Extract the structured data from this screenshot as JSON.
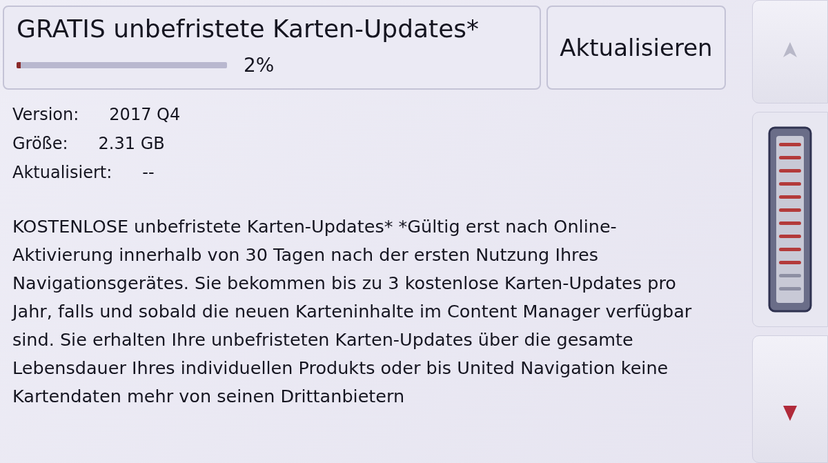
{
  "header": {
    "title": "GRATIS unbefristete Karten-Updates*",
    "progress": {
      "level": 0.02,
      "reading": "2%"
    }
  },
  "update_button": {
    "label": "Aktualisieren"
  },
  "details": [
    {
      "label": "Version:",
      "value": "2017 Q4"
    },
    {
      "label": "Größe:",
      "value": "2.31 GB"
    },
    {
      "label": "Aktualisiert:",
      "value": "--"
    }
  ],
  "description": "KOSTENLOSE unbefristete Karten-Updates* *Gültig erst nach Online-Aktivierung innerhalb von 30 Tagen nach der ersten Nutzung Ihres Navigationsgerätes. Sie bekommen bis zu 3 kostenlose Karten-Updates pro Jahr, falls und sobald die neuen Karteninhalte im Content Manager verfügbar sind. Sie erhalten Ihre unbefristeten Karten-Updates über die gesamte Lebensdauer Ihres individuellen Produkts oder bis United Navigation keine Kartendaten mehr von seinen Drittanbietern"
}
